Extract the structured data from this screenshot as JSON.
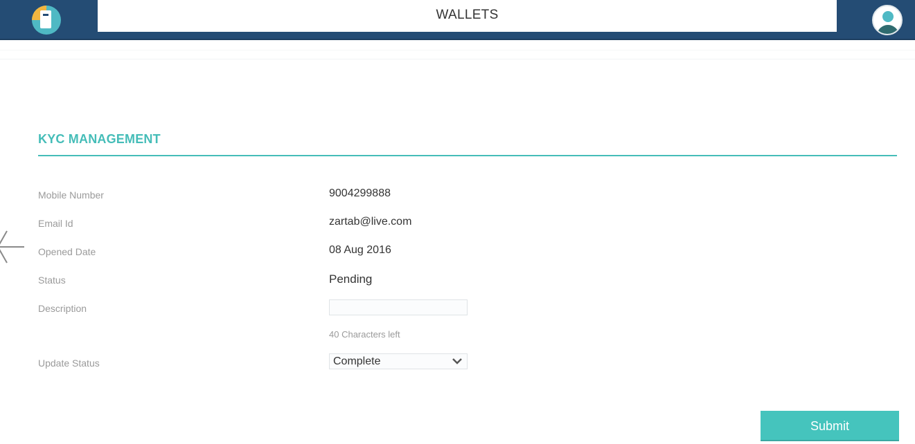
{
  "header": {
    "title": "WALLETS",
    "logo_icon": "wallet-logo-icon",
    "avatar_icon": "user-avatar-icon",
    "colors": {
      "bar": "#244c74",
      "accent": "#4fb9c4"
    }
  },
  "nav": {
    "back_icon": "arrow-left-icon"
  },
  "section": {
    "title": "KYC MANAGEMENT",
    "accent_color": "#45bdb8"
  },
  "fields": {
    "mobile": {
      "label": "Mobile Number",
      "value": "9004299888"
    },
    "email": {
      "label": "Email Id",
      "value": "zartab@live.com"
    },
    "opened": {
      "label": "Opened Date",
      "value": "08 Aug 2016"
    },
    "status": {
      "label": "Status",
      "value": "Pending"
    },
    "description": {
      "label": "Description",
      "value": "",
      "placeholder": "",
      "counter": "40 Characters left"
    },
    "update_status": {
      "label": "Update Status",
      "selected": "Complete"
    }
  },
  "actions": {
    "submit_label": "Submit",
    "submit_color": "#45c4bd"
  }
}
